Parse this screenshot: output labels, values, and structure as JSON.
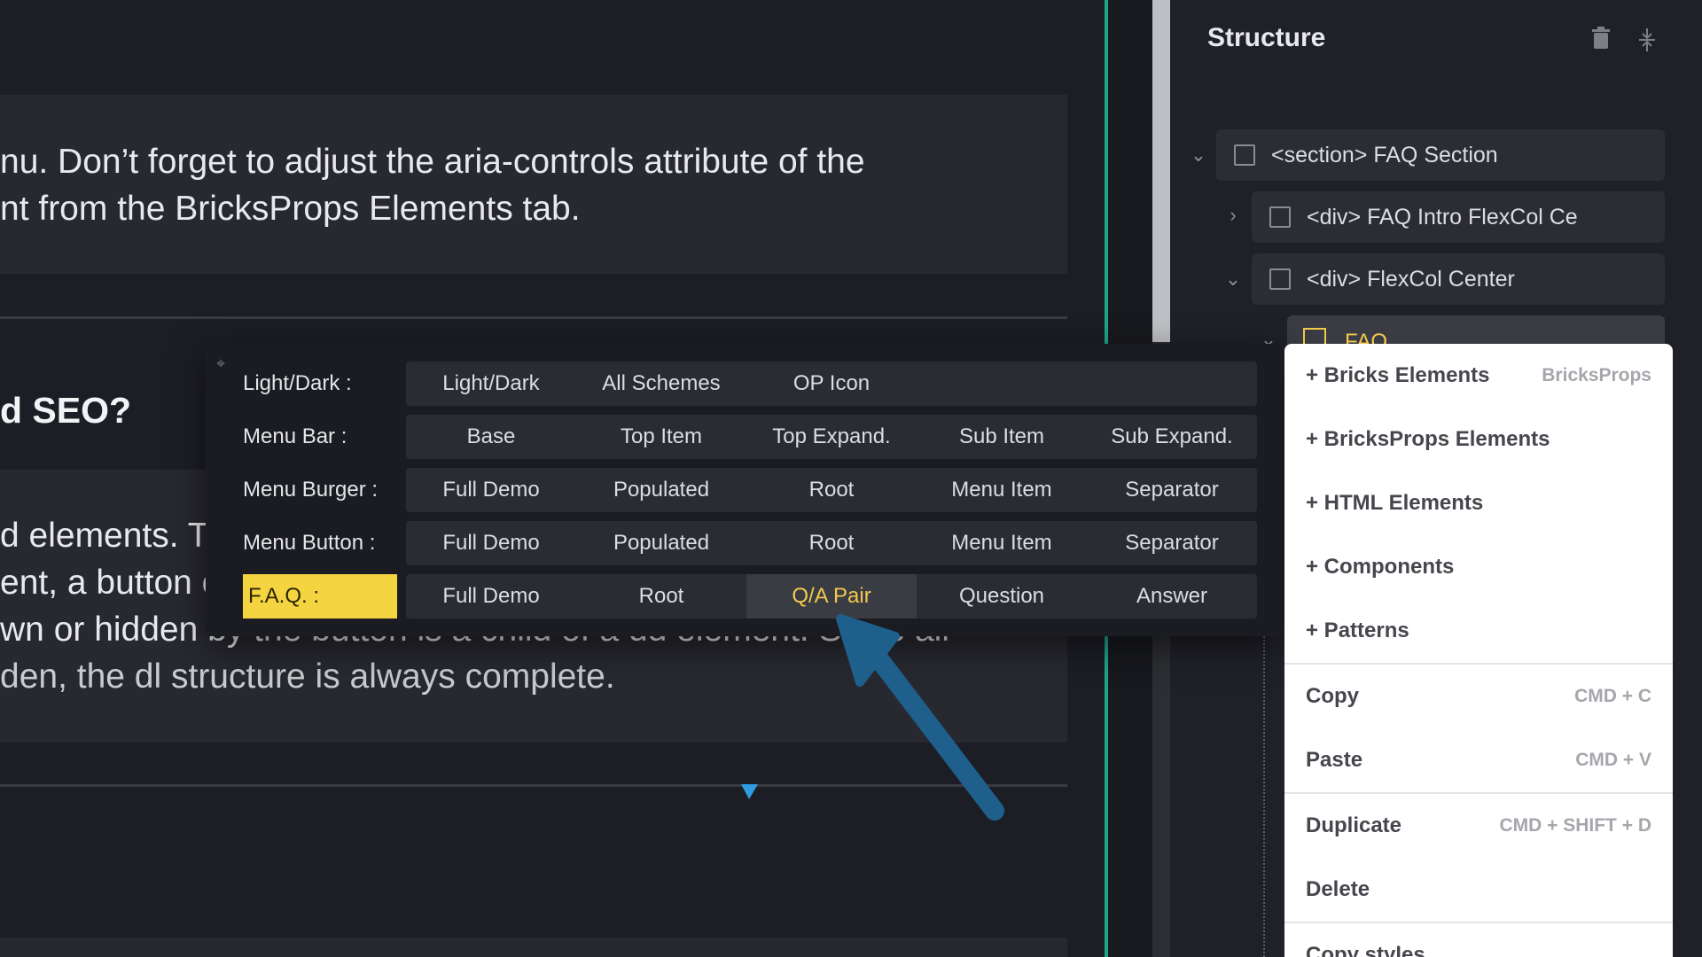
{
  "canvas": {
    "para1_line1": "nu. Don’t forget to adjust the aria-controls attribute of the",
    "para1_line2": "nt from the BricksProps Elements tab.",
    "heading": "d SEO?",
    "para2_line1": "d elements. T",
    "para2_line2": "ent, a button e",
    "para2_line3": "wn or hidden by the button is a child of a dd element. Since all",
    "para2_line4": "den, the dl structure is always complete."
  },
  "structure_panel": {
    "title": "Structure",
    "delete_icon": "trash-icon",
    "collapse_icon": "collapse-icon",
    "items": [
      {
        "label": "<section> FAQ Section"
      },
      {
        "label": "<div> FAQ Intro FlexCol Ce"
      },
      {
        "label": "<div> FlexCol Center"
      },
      {
        "label": "FAQ"
      }
    ]
  },
  "popup": {
    "rows": [
      {
        "label": "Light/Dark :",
        "buttons": [
          "Light/Dark",
          "All Schemes",
          "OP Icon"
        ]
      },
      {
        "label": "Menu Bar :",
        "buttons": [
          "Base",
          "Top Item",
          "Top Expand.",
          "Sub Item",
          "Sub Expand."
        ]
      },
      {
        "label": "Menu Burger :",
        "buttons": [
          "Full Demo",
          "Populated",
          "Root",
          "Menu Item",
          "Separator"
        ]
      },
      {
        "label": "Menu Button :",
        "buttons": [
          "Full Demo",
          "Populated",
          "Root",
          "Menu Item",
          "Separator"
        ]
      },
      {
        "label": "F.A.Q. :",
        "buttons": [
          "Full Demo",
          "Root",
          "Q/A Pair",
          "Question",
          "Answer"
        ]
      }
    ],
    "active_row": "F.A.Q. :",
    "selected_button": "Q/A Pair"
  },
  "context_menu": {
    "items": [
      {
        "label": "+ Bricks Elements",
        "hint": "BricksProps"
      },
      {
        "label": "+ BricksProps Elements",
        "hint": ""
      },
      {
        "label": "+ HTML Elements",
        "hint": ""
      },
      {
        "label": "+ Components",
        "hint": ""
      },
      {
        "label": "+ Patterns",
        "hint": ""
      },
      {
        "label": "Copy",
        "hint": "CMD + C"
      },
      {
        "label": "Paste",
        "hint": "CMD + V"
      },
      {
        "label": "Duplicate",
        "hint": "CMD + SHIFT + D"
      },
      {
        "label": "Delete",
        "hint": ""
      },
      {
        "label": "Copy styles",
        "hint": ""
      }
    ]
  },
  "colors": {
    "accent_yellow": "#f5d442",
    "selected_text": "#f2c94c",
    "canvas_divider": "#1fa58a",
    "arrow": "#1e5f8c",
    "marker": "#2f9be0"
  }
}
